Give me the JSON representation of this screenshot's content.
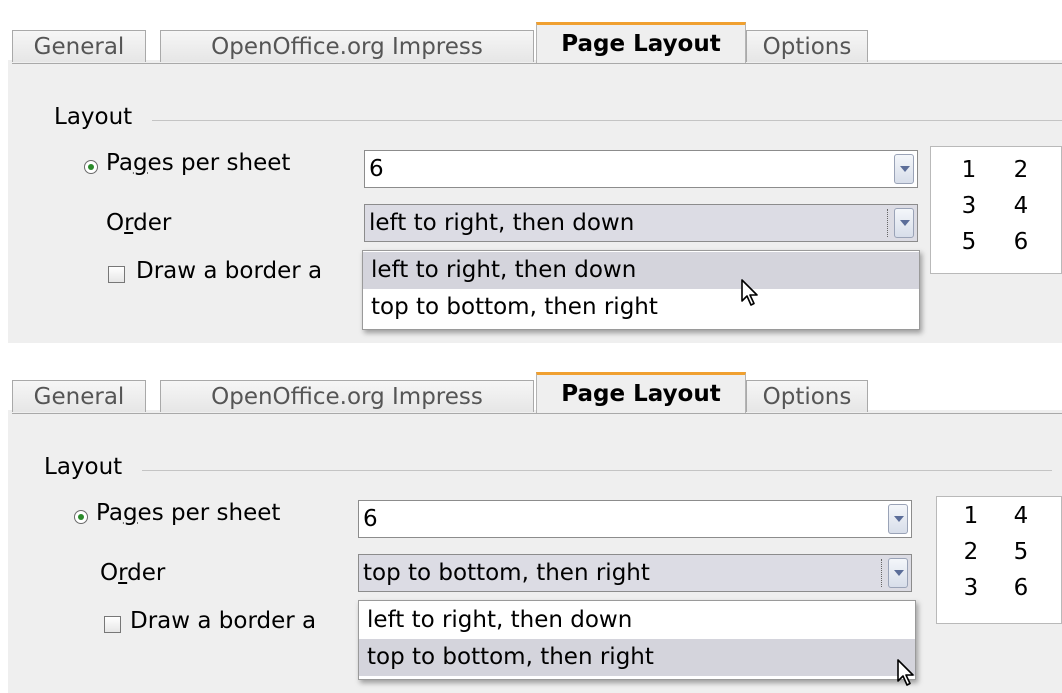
{
  "panels": [
    {
      "tabs": [
        {
          "label": "General"
        },
        {
          "label": "OpenOffice.org Impress"
        },
        {
          "label": "Page Layout"
        },
        {
          "label": "Options"
        }
      ],
      "active_tab": "Page Layout",
      "section_title": "Layout",
      "pages_per_sheet": {
        "label_pre": "Pa",
        "label_u": "g",
        "label_post": "es per sheet",
        "value": "6"
      },
      "order": {
        "label_pre": "O",
        "label_u": "r",
        "label_post": "der",
        "value": "left to right, then down"
      },
      "border_checkbox": {
        "label": "Draw a border a",
        "checked": false
      },
      "dropdown_options": [
        {
          "label": "left to right, then down"
        },
        {
          "label": "top to bottom, then right"
        }
      ],
      "highlighted_option": "left to right, then down",
      "preview": [
        "1",
        "2",
        "3",
        "4",
        "5",
        "6"
      ]
    },
    {
      "tabs": [
        {
          "label": "General"
        },
        {
          "label": "OpenOffice.org Impress"
        },
        {
          "label": "Page Layout"
        },
        {
          "label": "Options"
        }
      ],
      "active_tab": "Page Layout",
      "section_title": "Layout",
      "pages_per_sheet": {
        "label_pre": "Pa",
        "label_u": "g",
        "label_post": "es per sheet",
        "value": "6"
      },
      "order": {
        "label_pre": "O",
        "label_u": "r",
        "label_post": "der",
        "value": "top to bottom, then right"
      },
      "border_checkbox": {
        "label": "Draw a border a",
        "checked": false
      },
      "dropdown_options": [
        {
          "label": "left to right, then down"
        },
        {
          "label": "top to bottom, then right"
        }
      ],
      "highlighted_option": "top to bottom, then right",
      "preview": [
        "1",
        "4",
        "2",
        "5",
        "3",
        "6"
      ]
    }
  ],
  "colors": {
    "active_tab_accent": "#f0a030",
    "radio_dot": "#2a8a2a",
    "selection": "#d4d4dc"
  }
}
